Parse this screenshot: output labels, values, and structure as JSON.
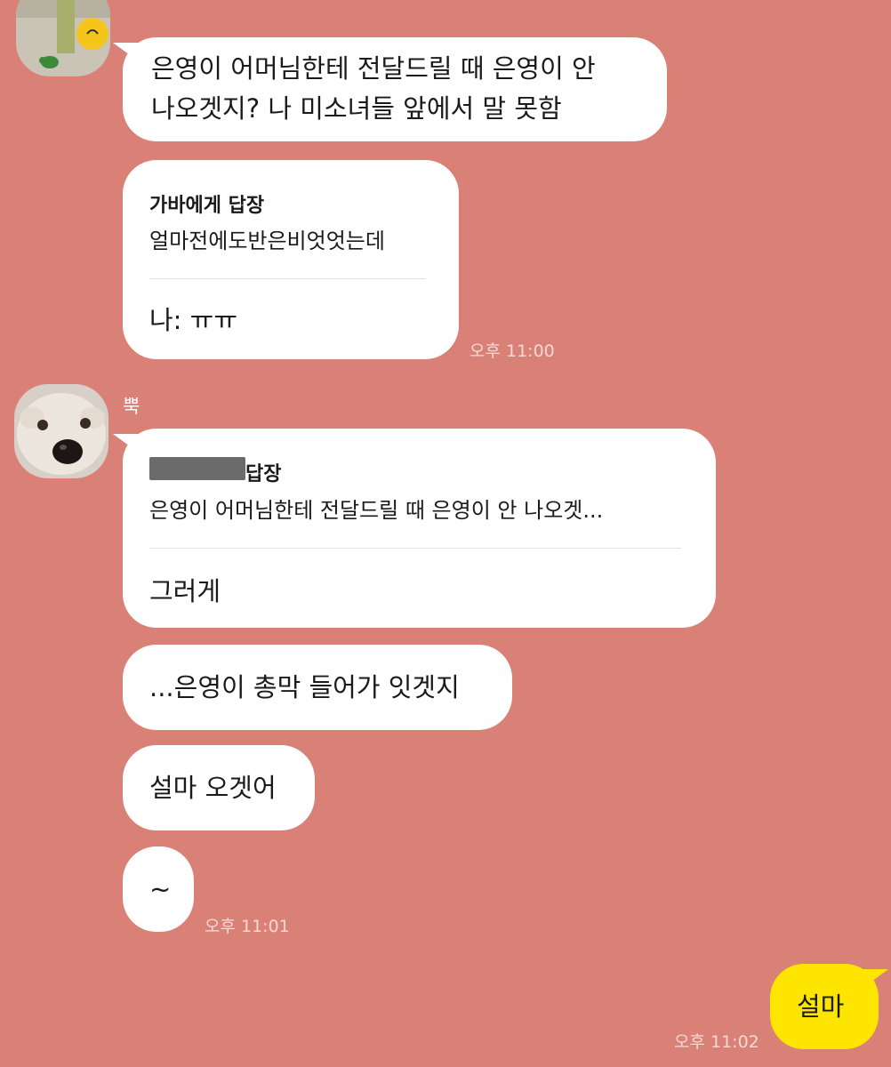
{
  "thread": {
    "first_group": {
      "message1": "은영이 어머님한테 전달드릴 때 은영이 안",
      "message1_line2": "나오겟지? 나 미소녀들 앞에서 말 못함",
      "reply_card": {
        "title": "가바에게 답장",
        "quote": "얼마전에도반은비엇엇는데",
        "body": "나: ㅠㅠ"
      },
      "timestamp": "오후 11:00"
    },
    "second_group": {
      "sender": "뿍",
      "reply_card": {
        "title_suffix": "답장",
        "quote": "은영이 어머님한테 전달드릴 때 은영이 안 나오겟...",
        "body": "그러게"
      },
      "message2": "...은영이 총막 들어가 잇겟지",
      "message3": "설마 오겟어",
      "message4": "~",
      "timestamp": "오후 11:01"
    },
    "my_message": {
      "text": "설마",
      "timestamp": "오후 11:02",
      "color": "#FEE500"
    }
  },
  "colors": {
    "background": "#DA8177",
    "bubble": "#FFFFFF"
  }
}
